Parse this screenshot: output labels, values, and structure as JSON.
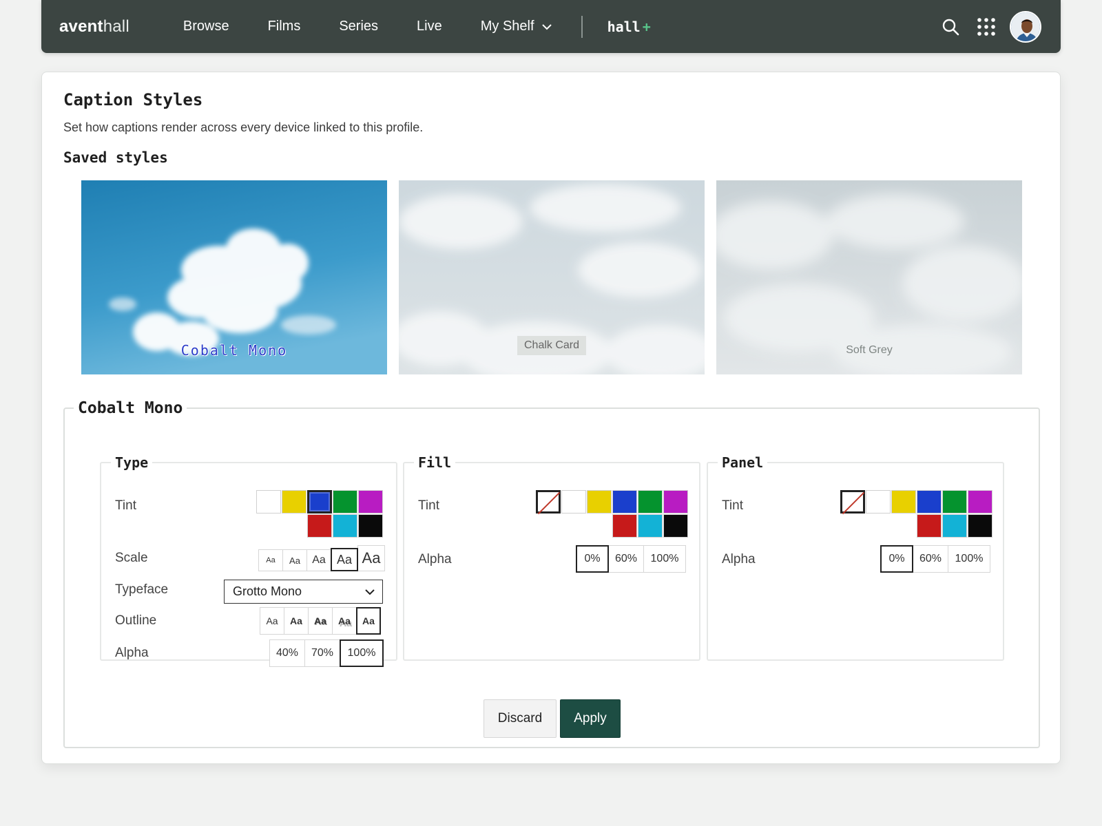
{
  "app": {
    "brand_bold": "avent",
    "brand_light": "hall",
    "nav": [
      "Browse",
      "Films",
      "Series",
      "Live",
      "My Shelf"
    ],
    "plus_logo": "hall",
    "plus_mark": "+"
  },
  "page": {
    "title": "Caption Styles",
    "subtitle": "Set how captions render across every device linked to this profile.",
    "saved_heading": "Saved styles"
  },
  "saved_styles": [
    {
      "label": "Cobalt Mono",
      "selected": true
    },
    {
      "label": "Chalk Card",
      "selected": false
    },
    {
      "label": "Soft Grey",
      "selected": false
    }
  ],
  "editor": {
    "style_name": "Cobalt Mono",
    "type": {
      "heading": "Type",
      "tint_label": "Tint",
      "tint_colors": [
        "#ffffff",
        "#e8d000",
        "#1a3fcc",
        "#05932e",
        "#b81cc2",
        "#c61a1a",
        "#13b2d6",
        "#0a0a0a"
      ],
      "tint_selected": "#1a3fcc",
      "scale_label": "Scale",
      "scale_options": [
        "Aa",
        "Aa",
        "Aa",
        "Aa",
        "Aa"
      ],
      "scale_selected_index": 3,
      "typeface_label": "Typeface",
      "typeface_value": "Grotto Mono",
      "outline_label": "Outline",
      "outline_options": [
        "Aa",
        "Aa",
        "Aa",
        "Aa",
        "Aa"
      ],
      "outline_selected_index": 4,
      "alpha_label": "Alpha",
      "alpha_options": [
        "40%",
        "70%",
        "100%"
      ],
      "alpha_selected": "100%"
    },
    "fill": {
      "heading": "Fill",
      "tint_label": "Tint",
      "tint_colors": [
        "none",
        "#ffffff",
        "#e8d000",
        "#1a3fcc",
        "#05932e",
        "#b81cc2",
        "#c61a1a",
        "#13b2d6",
        "#0a0a0a"
      ],
      "tint_selected": "none",
      "alpha_label": "Alpha",
      "alpha_options": [
        "0%",
        "60%",
        "100%"
      ],
      "alpha_selected": "0%"
    },
    "panel": {
      "heading": "Panel",
      "tint_label": "Tint",
      "tint_colors": [
        "none",
        "#ffffff",
        "#e8d000",
        "#1a3fcc",
        "#05932e",
        "#b81cc2",
        "#c61a1a",
        "#13b2d6",
        "#0a0a0a"
      ],
      "tint_selected": "none",
      "alpha_label": "Alpha",
      "alpha_options": [
        "0%",
        "60%",
        "100%"
      ],
      "alpha_selected": "0%"
    }
  },
  "actions": {
    "discard": "Discard",
    "apply": "Apply"
  },
  "colors": {
    "topbar": "#3c4542",
    "accent": "#1d4d43",
    "plus": "#58c48a"
  }
}
